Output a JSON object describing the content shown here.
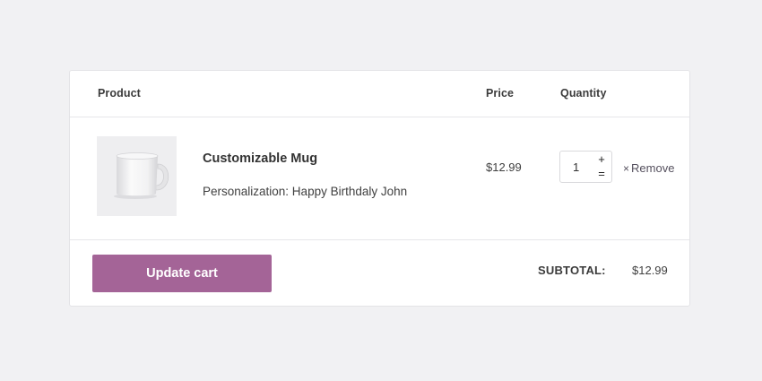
{
  "cart": {
    "headers": {
      "product": "Product",
      "price": "Price",
      "quantity": "Quantity"
    },
    "item": {
      "name": "Customizable Mug",
      "meta": "Personalization: Happy Birthdaly John",
      "price": "$12.99",
      "quantity": "1",
      "qty_increase": "+",
      "qty_decrease": "=",
      "remove_icon": "×",
      "remove_label": "Remove",
      "image": "mug-image"
    },
    "update_label": "Update cart",
    "subtotal_label": "SUBTOTAL:",
    "subtotal_value": "$12.99"
  },
  "colors": {
    "accent": "#a46497",
    "background": "#f1f1f3",
    "panel": "#ffffff"
  }
}
